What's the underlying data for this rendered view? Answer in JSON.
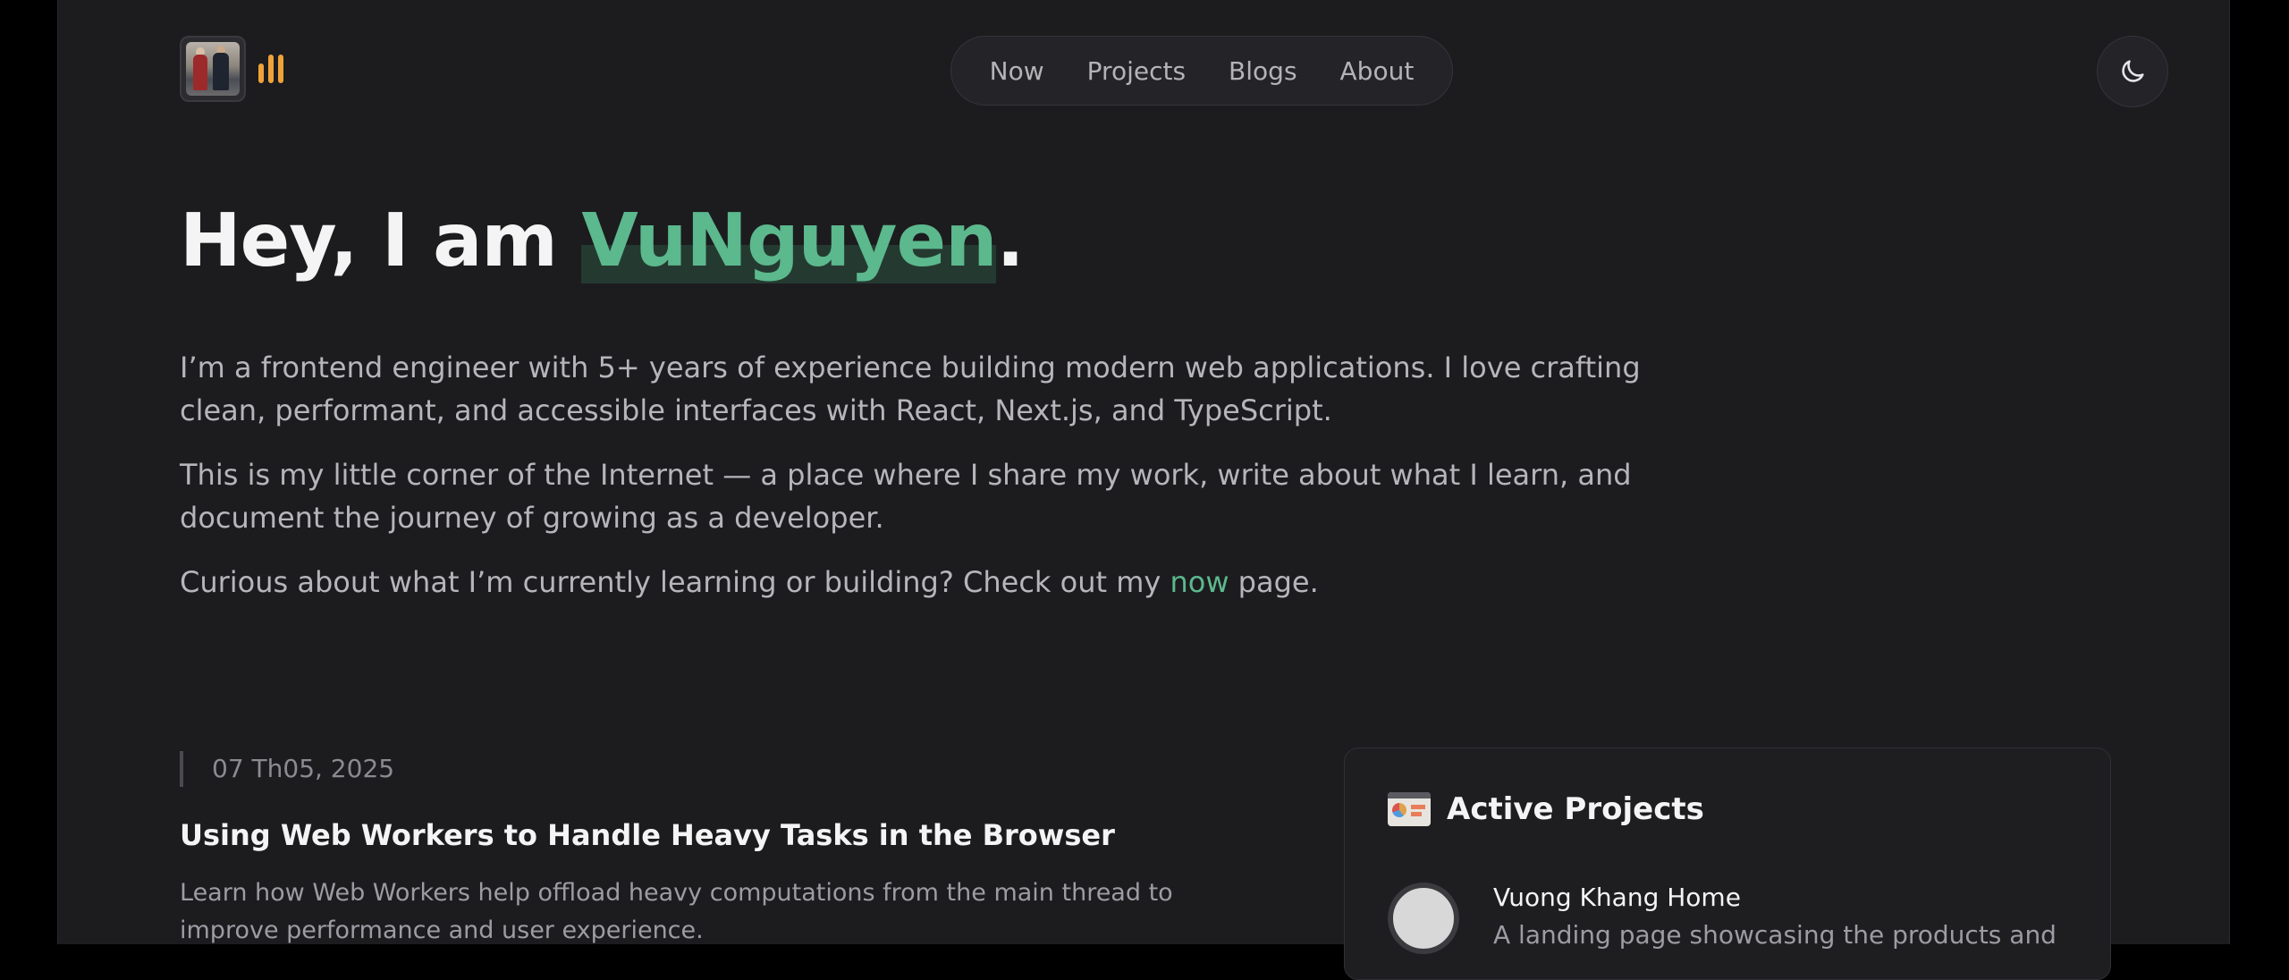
{
  "header": {
    "nav": [
      {
        "label": "Now"
      },
      {
        "label": "Projects"
      },
      {
        "label": "Blogs"
      },
      {
        "label": "About"
      }
    ]
  },
  "hero": {
    "greeting": "Hey, I am ",
    "name": "VuNguyen",
    "period": ".",
    "paragraph1": "I’m a frontend engineer with 5+ years of experience building modern web applications. I love crafting clean, performant, and accessible interfaces with React, Next.js, and TypeScript.",
    "paragraph2": "This is my little corner of the Internet — a place where I share my work, write about what I learn, and document the journey of growing as a developer.",
    "paragraph3_before": "Curious about what I’m currently learning or building? Check out my ",
    "paragraph3_link": "now",
    "paragraph3_after": " page."
  },
  "latest_post": {
    "date": "07 Th05, 2025",
    "title": "Using Web Workers to Handle Heavy Tasks in the Browser",
    "description": "Learn how Web Workers help offload heavy computations from the main thread to improve performance and user experience."
  },
  "active_projects": {
    "title": "Active Projects",
    "items": [
      {
        "name": "Vuong Khang Home",
        "description": "A landing page showcasing the products and"
      }
    ]
  },
  "colors": {
    "accent": "#5cb88d",
    "logo_bars": "#f0a23a",
    "background": "#1c1c1f"
  },
  "icons": {
    "theme_toggle": "moon-icon"
  }
}
